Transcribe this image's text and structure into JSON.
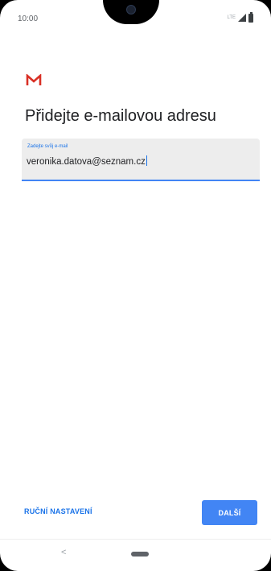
{
  "status_bar": {
    "time": "10:00",
    "network": "LTE",
    "icons": [
      "signal-icon",
      "battery-icon"
    ]
  },
  "app": {
    "logo": "gmail-logo-icon",
    "brand_color": "#d93025"
  },
  "page": {
    "title": "Přidejte e-mailovou adresu"
  },
  "email_field": {
    "label": "Zadejte svůj e-mail",
    "value": "veronika.datova@seznam.cz",
    "accent_color": "#4285f4"
  },
  "actions": {
    "manual_setup_label": "RUČNÍ NASTAVENÍ",
    "next_label": "DALŠÍ"
  },
  "nav_bar": {
    "back_symbol": "<"
  }
}
